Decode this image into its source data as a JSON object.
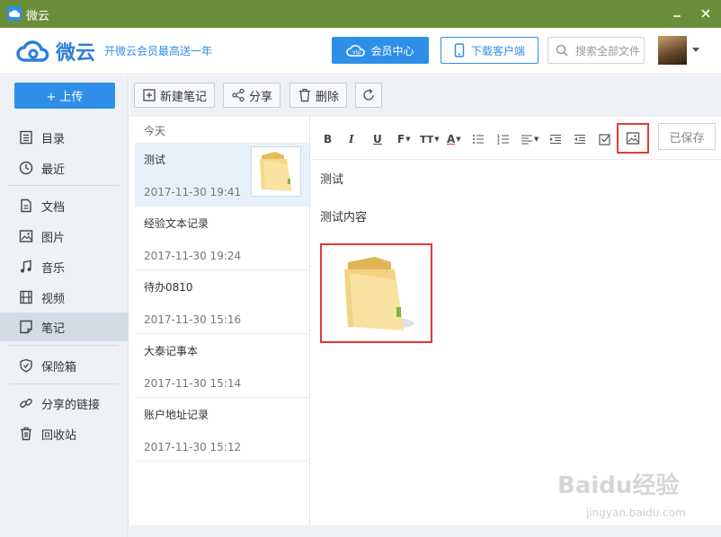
{
  "window": {
    "title": "微云"
  },
  "header": {
    "logo_text": "微云",
    "promo": "开微云会员最高送一年",
    "vip_button": "会员中心",
    "download_button": "下载客户端",
    "search_placeholder": "搜索全部文件"
  },
  "sidebar": {
    "upload_label": "+ 上传",
    "items": [
      {
        "label": "目录",
        "icon": "list-icon"
      },
      {
        "label": "最近",
        "icon": "clock-icon"
      },
      {
        "label": "文档",
        "icon": "document-icon"
      },
      {
        "label": "图片",
        "icon": "image-icon"
      },
      {
        "label": "音乐",
        "icon": "music-icon"
      },
      {
        "label": "视频",
        "icon": "video-icon"
      },
      {
        "label": "笔记",
        "icon": "note-icon",
        "active": true
      },
      {
        "label": "保险箱",
        "icon": "shield-icon"
      },
      {
        "label": "分享的链接",
        "icon": "link-icon"
      },
      {
        "label": "回收站",
        "icon": "trash-icon"
      }
    ]
  },
  "toolbar": {
    "new_note": "新建笔记",
    "share": "分享",
    "delete": "删除"
  },
  "notes": {
    "group_label": "今天",
    "items": [
      {
        "title": "测试",
        "date": "2017-11-30 19:41",
        "has_thumb": true,
        "active": true
      },
      {
        "title": "经验文本记录",
        "date": "2017-11-30 19:24"
      },
      {
        "title": "待办0810",
        "date": "2017-11-30 15:16"
      },
      {
        "title": "大泰记事本",
        "date": "2017-11-30 15:14"
      },
      {
        "title": "账户地址记录",
        "date": "2017-11-30 15:12"
      }
    ]
  },
  "editor": {
    "format_buttons": [
      "B",
      "I",
      "U",
      "F",
      "TT",
      "A"
    ],
    "saved_label": "已保存",
    "line1": "测试",
    "line2": "测试内容"
  },
  "watermark": {
    "line1": "Baidu经验",
    "line2": "jingyan.baidu.com"
  },
  "colors": {
    "titlebar": "#6b8e3a",
    "accent": "#2f8fe8",
    "highlight": "#e03a3a"
  }
}
